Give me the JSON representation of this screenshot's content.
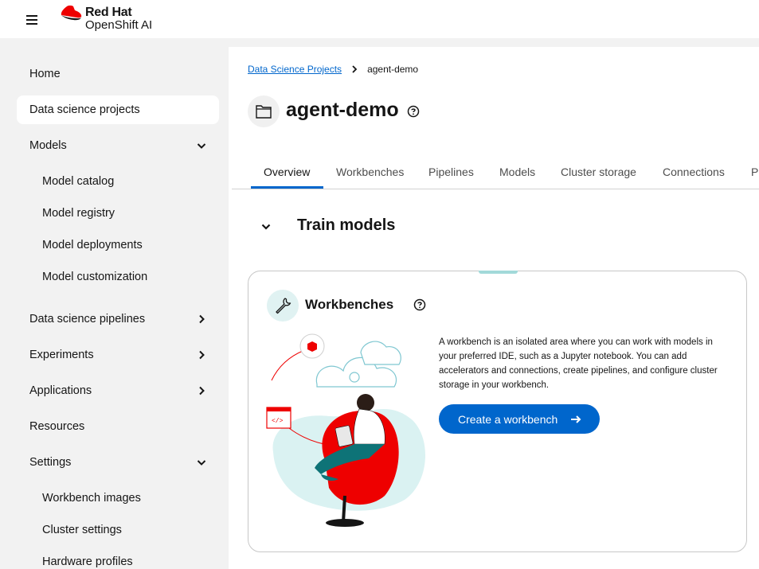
{
  "brand": {
    "line1": "Red Hat",
    "line2": "OpenShift AI"
  },
  "sidebar": {
    "items": [
      {
        "label": "Home"
      },
      {
        "label": "Data science projects"
      },
      {
        "label": "Models"
      },
      {
        "label": "Model catalog"
      },
      {
        "label": "Model registry"
      },
      {
        "label": "Model deployments"
      },
      {
        "label": "Model customization"
      },
      {
        "label": "Data science pipelines"
      },
      {
        "label": "Experiments"
      },
      {
        "label": "Applications"
      },
      {
        "label": "Resources"
      },
      {
        "label": "Settings"
      },
      {
        "label": "Workbench images"
      },
      {
        "label": "Cluster settings"
      },
      {
        "label": "Hardware profiles"
      }
    ]
  },
  "breadcrumb": {
    "parent": "Data Science Projects",
    "current": "agent-demo"
  },
  "project": {
    "title": "agent-demo"
  },
  "tabs": [
    {
      "label": "Overview"
    },
    {
      "label": "Workbenches"
    },
    {
      "label": "Pipelines"
    },
    {
      "label": "Models"
    },
    {
      "label": "Cluster storage"
    },
    {
      "label": "Connections"
    },
    {
      "label": "Pe"
    }
  ],
  "section": {
    "title": "Train models"
  },
  "card": {
    "title": "Workbenches",
    "description": "A workbench is an isolated area where you can work with models in your preferred IDE, such as a Jupyter notebook. You can add accelerators and connections, create pipelines, and configure cluster storage in your workbench.",
    "button_label": "Create a workbench"
  },
  "colors": {
    "accent": "#0066cc",
    "sidebar_bg": "#f2f2f2",
    "brand_red": "#ee0000"
  }
}
